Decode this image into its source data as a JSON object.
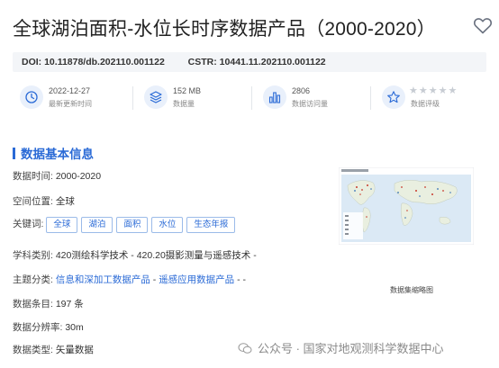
{
  "title": "全球湖泊面积-水位长时序数据产品（2000-2020）",
  "doi_bar": {
    "doi_label": "DOI:",
    "doi_value": "10.11878/db.202110.001122",
    "cstr_label": "CSTR:",
    "cstr_value": "10441.11.202110.001122"
  },
  "stats": {
    "updated": {
      "value": "2022-12-27",
      "label": "最新更新时间",
      "icon": "clock-icon"
    },
    "size": {
      "value": "152 MB",
      "label": "数据量",
      "icon": "layers-icon"
    },
    "visits": {
      "value": "2806",
      "label": "数据访问量",
      "icon": "bar-chart-icon"
    },
    "rating": {
      "label": "数据评级",
      "icon": "star-icon",
      "stars": 0,
      "max_stars": 5
    }
  },
  "section": {
    "title": "数据基本信息"
  },
  "info": {
    "time_label": "数据时间:",
    "time_value": "2000-2020",
    "space_label": "空间位置:",
    "space_value": "全球",
    "keywords_label": "关键词:",
    "keywords": [
      "全球",
      "湖泊",
      "面积",
      "水位",
      "生态年报"
    ],
    "subject_label": "学科类别:",
    "subject_value": "420测绘科学技术 - 420.20摄影测量与遥感技术 -",
    "theme_label": "主题分类:",
    "theme_part1": "信息和深加工数据产品",
    "theme_sep": " - ",
    "theme_part2": "遥感应用数据产品",
    "theme_tail": " - -",
    "records_label": "数据条目:",
    "records_value": "197 条",
    "resolution_label": "数据分辨率:",
    "resolution_value": "30m",
    "type_label": "数据类型:",
    "type_value": "矢量数据"
  },
  "thumbnail": {
    "caption": "数据集缩略图"
  },
  "watermark": {
    "text": "公众号 · 国家对地观测科学数据中心"
  },
  "colors": {
    "accent": "#2a6ad6",
    "doi_bg": "#f3f5f8",
    "icon_bg": "#e9f0fb"
  }
}
